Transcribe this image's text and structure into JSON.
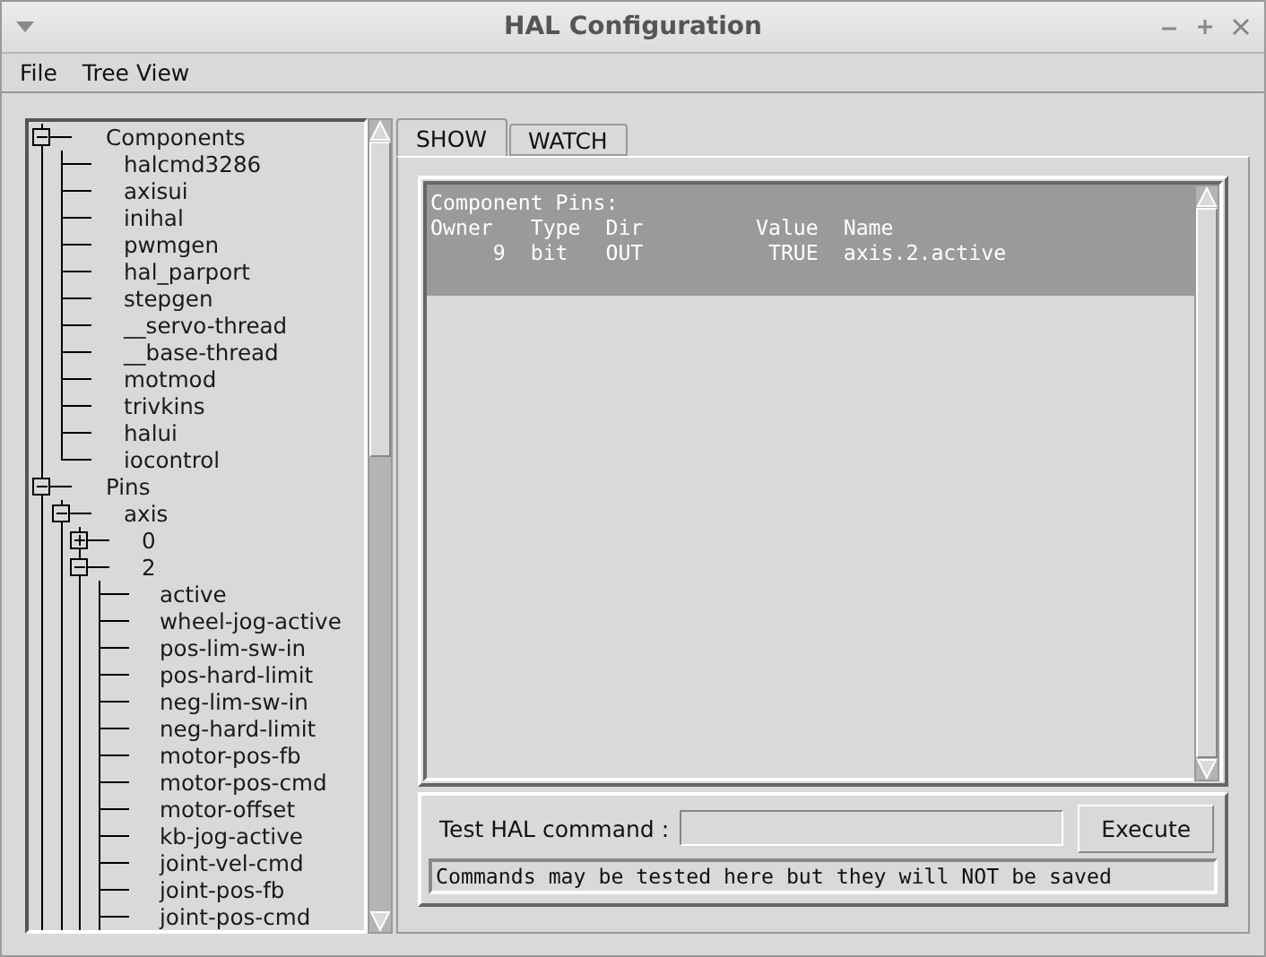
{
  "window": {
    "title": "HAL Configuration"
  },
  "menu": [
    "File",
    "Tree View"
  ],
  "tree": [
    {
      "label": "Components",
      "expanded": true,
      "children": [
        {
          "label": "halcmd3286"
        },
        {
          "label": "axisui"
        },
        {
          "label": "inihal"
        },
        {
          "label": "pwmgen"
        },
        {
          "label": "hal_parport"
        },
        {
          "label": "stepgen"
        },
        {
          "label": "__servo-thread"
        },
        {
          "label": "__base-thread"
        },
        {
          "label": "motmod"
        },
        {
          "label": "trivkins"
        },
        {
          "label": "halui"
        },
        {
          "label": "iocontrol"
        }
      ]
    },
    {
      "label": "Pins",
      "expanded": true,
      "children": [
        {
          "label": "axis",
          "expanded": true,
          "children": [
            {
              "label": "0",
              "expanded": false
            },
            {
              "label": "2",
              "expanded": true,
              "children": [
                {
                  "label": "active"
                },
                {
                  "label": "wheel-jog-active"
                },
                {
                  "label": "pos-lim-sw-in"
                },
                {
                  "label": "pos-hard-limit"
                },
                {
                  "label": "neg-lim-sw-in"
                },
                {
                  "label": "neg-hard-limit"
                },
                {
                  "label": "motor-pos-fb"
                },
                {
                  "label": "motor-pos-cmd"
                },
                {
                  "label": "motor-offset"
                },
                {
                  "label": "kb-jog-active"
                },
                {
                  "label": "joint-vel-cmd"
                },
                {
                  "label": "joint-pos-fb"
                },
                {
                  "label": "joint-pos-cmd"
                }
              ]
            }
          ]
        }
      ]
    }
  ],
  "tabs": [
    {
      "label": "SHOW",
      "selected": true
    },
    {
      "label": "WATCH",
      "selected": false
    }
  ],
  "output": {
    "lines": [
      "Component Pins:",
      "Owner   Type  Dir         Value  Name",
      "     9  bit   OUT          TRUE  axis.2.active"
    ]
  },
  "command": {
    "label": "Test HAL command :",
    "button": "Execute",
    "status": "Commands may be tested here but they will NOT be saved"
  }
}
